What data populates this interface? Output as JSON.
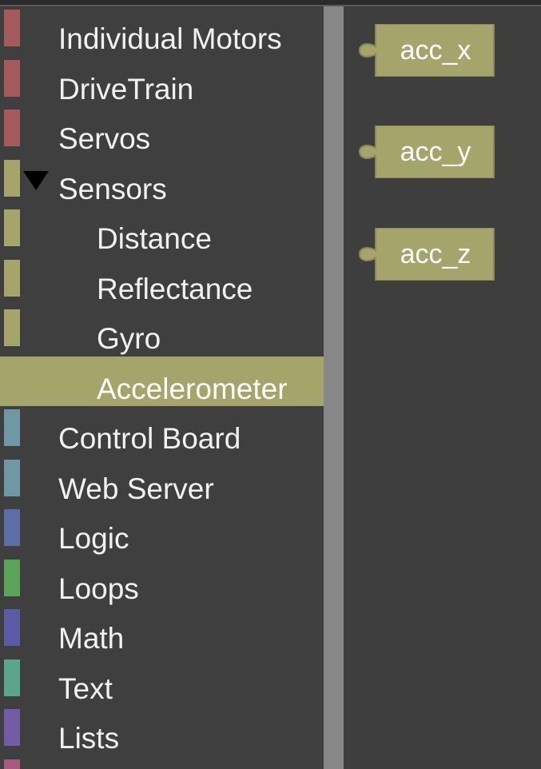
{
  "toolbox": {
    "categories": [
      {
        "label": "Individual Motors",
        "color": "#a55b5b",
        "level": 0
      },
      {
        "label": "DriveTrain",
        "color": "#a55b5b",
        "level": 0
      },
      {
        "label": "Servos",
        "color": "#a55b5b",
        "level": 0
      },
      {
        "label": "Sensors",
        "color": "#a5a46a",
        "level": 0,
        "expanded": true
      },
      {
        "label": "Distance",
        "color": "#a5a46a",
        "level": 1
      },
      {
        "label": "Reflectance",
        "color": "#a5a46a",
        "level": 1
      },
      {
        "label": "Gyro",
        "color": "#a5a46a",
        "level": 1
      },
      {
        "label": "Accelerometer",
        "color": "#a5a46a",
        "level": 1,
        "selected": true
      },
      {
        "label": "Control Board",
        "color": "#6e98a6",
        "level": 0
      },
      {
        "label": "Web Server",
        "color": "#6e98a6",
        "level": 0
      },
      {
        "label": "Logic",
        "color": "#5b6ea5",
        "level": 0
      },
      {
        "label": "Loops",
        "color": "#5ba55b",
        "level": 0
      },
      {
        "label": "Math",
        "color": "#5b5ba5",
        "level": 0
      },
      {
        "label": "Text",
        "color": "#5ba58c",
        "level": 0
      },
      {
        "label": "Lists",
        "color": "#745ba5",
        "level": 0
      },
      {
        "label": "",
        "color": "#a55b80",
        "level": 0
      }
    ]
  },
  "flyout": {
    "blocks": [
      {
        "label": "acc_x",
        "color": "#a5a46a"
      },
      {
        "label": "acc_y",
        "color": "#a5a46a"
      },
      {
        "label": "acc_z",
        "color": "#a5a46a"
      }
    ]
  }
}
